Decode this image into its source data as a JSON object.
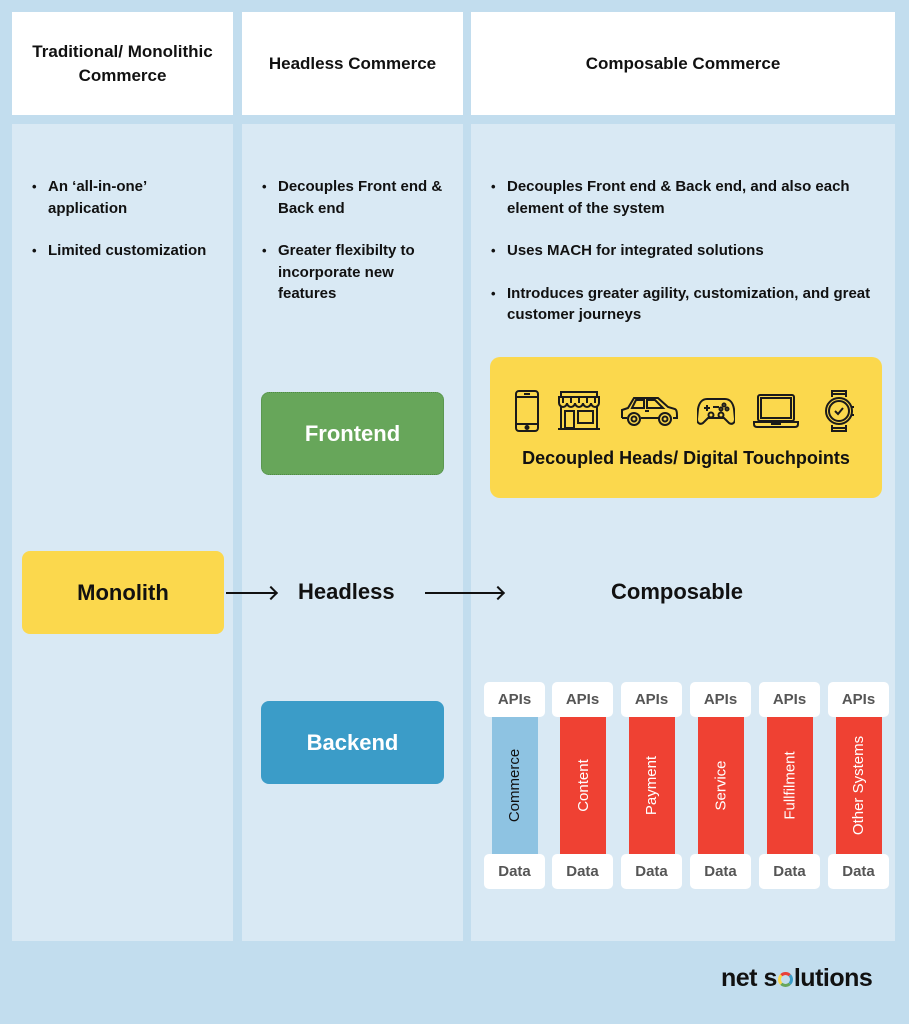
{
  "columns": [
    {
      "header": "Traditional/ Monolithic Commerce",
      "bullets": [
        "An ‘all-in-one’ application",
        "Limited customization"
      ]
    },
    {
      "header": "Headless Commerce",
      "bullets": [
        "Decouples Front end  &  Back end",
        "Greater flexibilty to incorporate new features"
      ]
    },
    {
      "header": "Composable Commerce",
      "bullets": [
        "Decouples Front end &  Back end, and also each element of the system",
        "Uses MACH for integrated solutions",
        "Introduces greater agility, customization, and great customer journeys"
      ]
    }
  ],
  "headless": {
    "frontend_label": "Frontend",
    "backend_label": "Backend"
  },
  "progression": {
    "monolith_label": "Monolith",
    "headless_label": "Headless",
    "composable_label": "Composable"
  },
  "touchpoints": {
    "label": "Decoupled Heads/ Digital Touchpoints",
    "icons": [
      "smartphone-icon",
      "storefront-icon",
      "car-icon",
      "gamepad-icon",
      "laptop-icon",
      "smartwatch-icon"
    ]
  },
  "services": {
    "api_label": "APIs",
    "data_label": "Data",
    "items": [
      {
        "name": "Commerce",
        "color": "#8ec3e2",
        "text_color": "#111111"
      },
      {
        "name": "Content",
        "color": "#ef4133",
        "text_color": "#ffffff"
      },
      {
        "name": "Payment",
        "color": "#ef4133",
        "text_color": "#ffffff"
      },
      {
        "name": "Service",
        "color": "#ef4133",
        "text_color": "#ffffff"
      },
      {
        "name": "Fullfilment",
        "color": "#ef4133",
        "text_color": "#ffffff"
      },
      {
        "name": "Other Systems",
        "color": "#ef4133",
        "text_color": "#ffffff"
      }
    ]
  },
  "colors": {
    "background": "#c2ddee",
    "panel": "#d9e9f4",
    "yellow": "#fbd84d",
    "green": "#67a65a",
    "blue": "#3b9cc8",
    "red": "#ef4133"
  },
  "brand": {
    "logo_prefix": "net s",
    "logo_suffix": "lutions"
  }
}
